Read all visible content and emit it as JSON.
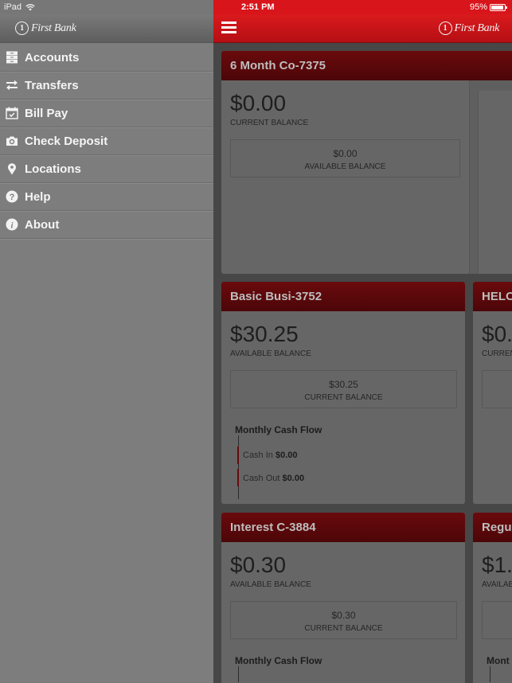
{
  "sidebar": {
    "status": {
      "device": "iPad",
      "wifi_icon": "wifi-icon"
    },
    "logo_text": "First Bank",
    "logo_mark": "1",
    "items": [
      {
        "label": "Accounts",
        "icon": "accounts-drawer-icon"
      },
      {
        "label": "Transfers",
        "icon": "transfer-arrows-icon"
      },
      {
        "label": "Bill Pay",
        "icon": "calendar-check-icon"
      },
      {
        "label": "Check Deposit",
        "icon": "camera-icon"
      },
      {
        "label": "Locations",
        "icon": "map-pin-icon"
      },
      {
        "label": "Help",
        "icon": "question-circle-icon"
      },
      {
        "label": "About",
        "icon": "info-circle-icon"
      }
    ]
  },
  "status_bar": {
    "time": "2:51 PM",
    "battery": "95%",
    "battery_level": 0.95
  },
  "header": {
    "logo_text": "First Bank",
    "logo_mark": "1",
    "menu_icon": "hamburger-icon"
  },
  "colors": {
    "brand_red": "#d8151b",
    "card_header": "#5a0709"
  },
  "accounts": [
    {
      "name": "6 Month Co-7375",
      "primary_amount": "$0.00",
      "primary_label": "CURRENT BALANCE",
      "secondary_amount": "$0.00",
      "secondary_label": "AVAILABLE BALANCE"
    },
    {
      "name": "Basic Busi-3752",
      "primary_amount": "$30.25",
      "primary_label": "AVAILABLE BALANCE",
      "secondary_amount": "$30.25",
      "secondary_label": "CURRENT BALANCE",
      "cash_flow": {
        "title": "Monthly Cash Flow",
        "in_label": "Cash In",
        "in_value": "$0.00",
        "out_label": "Cash Out",
        "out_value": "$0.00"
      }
    },
    {
      "name": "HELO",
      "primary_amount": "$0.",
      "primary_label": "CURREN"
    },
    {
      "name": "Interest C-3884",
      "primary_amount": "$0.30",
      "primary_label": "AVAILABLE BALANCE",
      "secondary_amount": "$0.30",
      "secondary_label": "CURRENT BALANCE",
      "cash_flow": {
        "title": "Monthly Cash Flow"
      }
    },
    {
      "name": "Regu",
      "primary_amount": "$1.",
      "primary_label": "AVAILAB",
      "cash_flow": {
        "title": "Mont"
      }
    }
  ]
}
